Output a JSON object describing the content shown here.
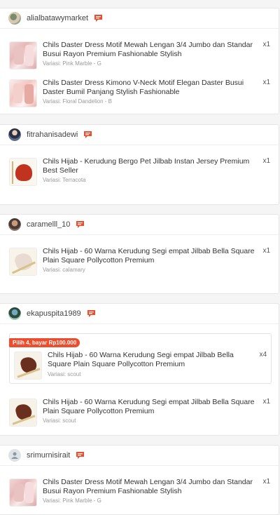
{
  "shops": [
    {
      "username": "alialbatawymarket",
      "items": [
        {
          "title": "Chils Daster Dress Motif Mewah Lengan 3/4 Jumbo dan Standar Busui Rayon Premium Fashionable Stylish",
          "variant": "Variasi: Pink Marble - G",
          "qty": "x1"
        },
        {
          "title": "Chils Daster Dress Kimono V-Neck Motif Elegan Daster Busui Daster Bumil Panjang Stylish Fashionable",
          "variant": "Variasi: Floral Dandelion - B",
          "qty": "x1"
        }
      ]
    },
    {
      "username": "fitrahanisadewi",
      "items": [
        {
          "title": "Chils Hijab - Kerudung Bergo Pet Jilbab Instan Jersey Premium Best Seller",
          "variant": "Variasi: Terracota",
          "qty": "x1"
        }
      ]
    },
    {
      "username": "caramelll_10",
      "items": [
        {
          "title": "Chils Hijab - 60 Warna Kerudung Segi empat Jilbab Bella Square Plain Square Pollycotton Premium",
          "variant": "Variasi: calamary",
          "qty": "x1"
        }
      ]
    },
    {
      "username": "ekapuspita1989",
      "promo_label": "Pilih 4, bayar Rp100.000",
      "promo_item": {
        "title": "Chils Hijab - 60 Warna Kerudung Segi empat Jilbab Bella Square Plain Square Pollycotton Premium",
        "variant": "Variasi: scout",
        "qty": "x4"
      },
      "items": [
        {
          "title": "Chils Hijab - 60 Warna Kerudung Segi empat Jilbab Bella Square Plain Square Pollycotton Premium",
          "variant": "Variasi: scout",
          "qty": "x1"
        }
      ]
    },
    {
      "username": "srimurnisirait",
      "items": [
        {
          "title": "Chils Daster Dress Motif Mewah Lengan 3/4 Jumbo dan Standar Busui Rayon Premium Fashionable Stylish",
          "variant": "Variasi: Pink Marble - G",
          "qty": "x1"
        }
      ]
    }
  ],
  "colors": {
    "accent": "#ee4d2d",
    "chat_icon": "#ee4d2d",
    "background": "#f5f5f5"
  },
  "icons": {
    "chat": "chat-bubble-icon",
    "avatar": "user-avatar"
  }
}
